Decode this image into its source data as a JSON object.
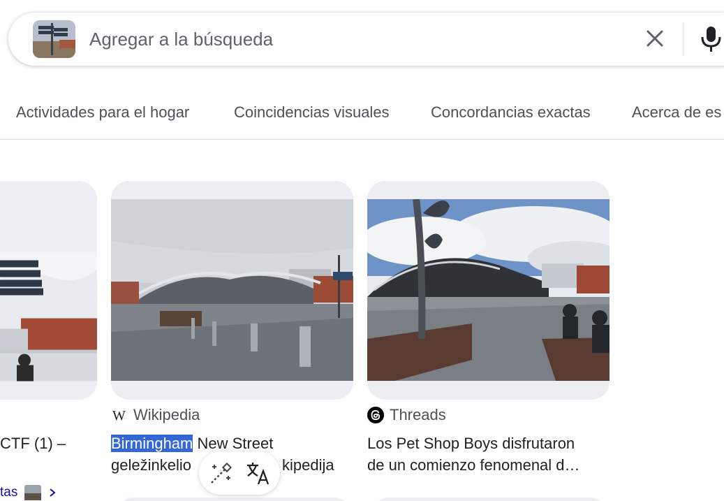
{
  "search": {
    "placeholder": "Agregar a la búsqueda",
    "thumbnail_icon": "image-thumbnail",
    "clear_icon": "close-icon",
    "mic_icon": "microphone-icon"
  },
  "tabs": [
    {
      "label": "Actividades para el hogar"
    },
    {
      "label": "Coincidencias visuales"
    },
    {
      "label": "Concordancias exactas"
    },
    {
      "label": "Acerca de es"
    }
  ],
  "results": [
    {
      "title_fragment": "CTF (1) –",
      "link_fragment": "tas"
    },
    {
      "source": "Wikipedia",
      "source_icon": "wikipedia-icon",
      "title_highlight": "Birmingham",
      "title_rest_line1": " New Street",
      "title_line2_part1": "geležinkelio",
      "title_line2_part2": "kipedija"
    },
    {
      "source": "Threads",
      "source_icon": "threads-icon",
      "title_line1": "Los Pet Shop Boys disfrutaron",
      "title_line2": "de un comienzo fenomenal d…"
    }
  ],
  "tools": {
    "magic_icon": "magic-wand-icon",
    "translate_icon": "translate-icon"
  },
  "colors": {
    "highlight": "#3367d6",
    "link": "#1a0dab",
    "card_bg": "#eceef1"
  }
}
